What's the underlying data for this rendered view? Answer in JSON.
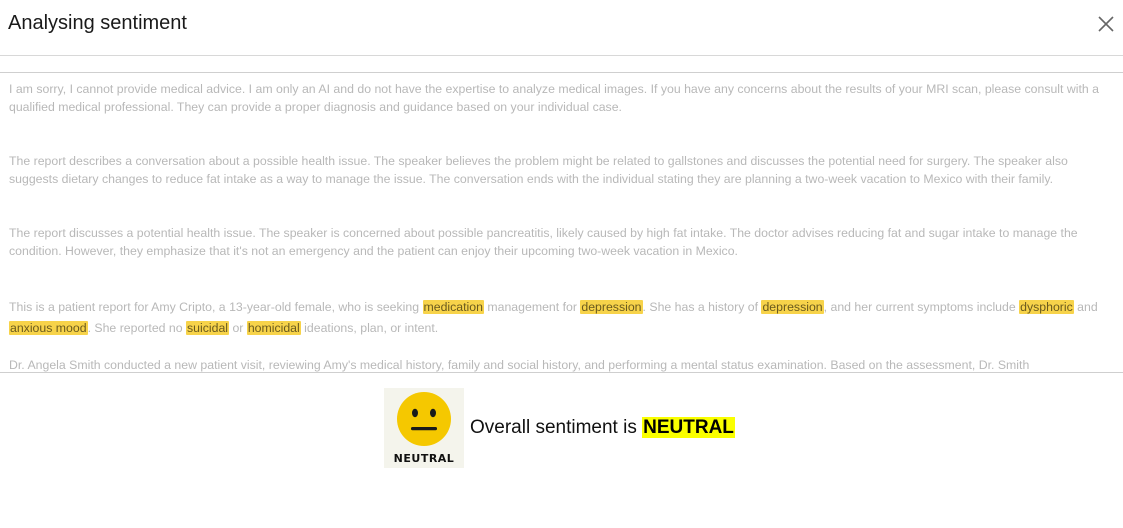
{
  "modal": {
    "title": "Analysing sentiment",
    "close_icon": "close-icon"
  },
  "paragraphs": {
    "p1": "I am sorry, I cannot provide medical advice. I am only an AI and do not have the expertise to analyze medical images. If you have any concerns about the results of your MRI scan, please consult with a qualified medical professional. They can provide a proper diagnosis and guidance based on your individual case.",
    "p2": "The report describes a conversation about a possible health issue. The speaker believes the problem might be related to gallstones and discusses the potential need for surgery. The speaker also suggests dietary changes to reduce fat intake as a way to manage the issue. The conversation ends with the individual stating they are planning a two-week vacation to Mexico with their family.",
    "p3": "The report discusses a potential health issue. The speaker is concerned about possible pancreatitis, likely caused by high fat intake. The doctor advises reducing fat and sugar intake to manage the condition. However, they emphasize that it's not an emergency and the patient can enjoy their upcoming two-week vacation in Mexico.",
    "p4": {
      "t1": "This is a patient report for Amy Cripto, a 13-year-old female, who is seeking ",
      "h1": "medication",
      "t2": " management for ",
      "h2": "depression",
      "t3": ". She has a history of ",
      "h3": "depression",
      "t4": ", and her current symptoms include ",
      "h4": "dysphoric",
      "t5": " and ",
      "h5": "anxious mood",
      "t6": ". She reported no ",
      "h6": "suicidal",
      "t7": " or ",
      "h7": "homicidal",
      "t8": " ideations, plan, or intent."
    },
    "p5": "Dr. Angela Smith conducted a new patient visit, reviewing Amy's medical history, family and social history, and performing a mental status examination. Based on the assessment, Dr. Smith"
  },
  "sentiment": {
    "icon": "neutral-face-icon",
    "icon_caption": "NEUTRAL",
    "label": "Overall sentiment is ",
    "value": "NEUTRAL"
  },
  "colors": {
    "highlight": "#f7d34a",
    "sentiment_highlight": "#faff00",
    "faded_text": "#b8b8b8",
    "emoji_face": "#f5c800"
  }
}
